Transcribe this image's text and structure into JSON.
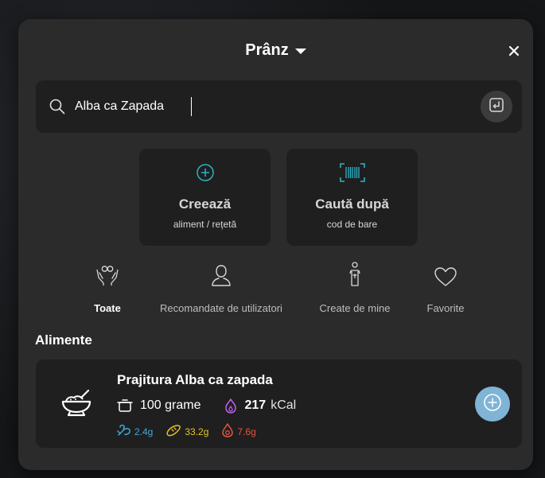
{
  "header": {
    "title": "Prânz",
    "dropdown_icon": "caret-down-icon",
    "close_icon": "close-icon"
  },
  "search": {
    "value": "Alba ca Zapada",
    "placeholder": "",
    "icon": "search-icon",
    "submit_icon": "enter-icon"
  },
  "actions": [
    {
      "title": "Creează",
      "subtitle": "aliment / rețetă",
      "icon": "plus-circle-icon",
      "accent": "#2bb3c7"
    },
    {
      "title": "Caută după",
      "subtitle": "cod de bare",
      "icon": "barcode-icon",
      "accent": "#2bb3c7"
    }
  ],
  "filters": [
    {
      "label": "Toate",
      "icon": "hands-icon",
      "active": true
    },
    {
      "label": "Recomandate de utilizatori",
      "icon": "user-icon",
      "active": false
    },
    {
      "label": "Create de mine",
      "icon": "chef-icon",
      "active": false
    },
    {
      "label": "Favorite",
      "icon": "heart-icon",
      "active": false
    }
  ],
  "section": {
    "title": "Alimente"
  },
  "foods": [
    {
      "name": "Prajitura Alba ca zapada",
      "icon": "food-bowl-icon",
      "quantity": "100 grame",
      "quantity_icon": "pot-icon",
      "kcal_value": "217",
      "kcal_unit": "kCal",
      "kcal_icon": "flame-icon",
      "macros": [
        {
          "value": "2.4g",
          "icon": "protein-icon",
          "color": "#3ea9d9"
        },
        {
          "value": "33.2g",
          "icon": "carbs-icon",
          "color": "#e6c229"
        },
        {
          "value": "7.6g",
          "icon": "fat-icon",
          "color": "#e5533f"
        }
      ],
      "add_icon": "add-circle-icon"
    }
  ],
  "colors": {
    "dialog_bg": "#2b2b2b",
    "card_bg": "#1f1f1f",
    "accent": "#2bb3c7",
    "kcal": "#c161f2",
    "add_button": "#7fb4d6"
  }
}
